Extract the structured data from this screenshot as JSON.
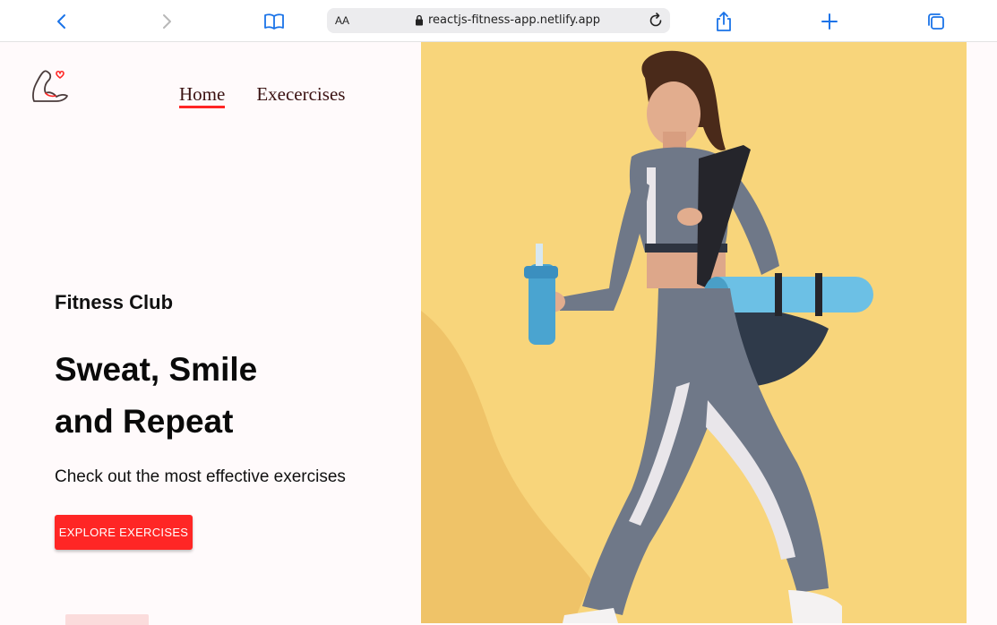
{
  "browser": {
    "aa_label": "AA",
    "url": "reactjs-fitness-app.netlify.app"
  },
  "nav": {
    "items": [
      {
        "label": "Home",
        "active": true
      },
      {
        "label": "Execercises",
        "active": false
      }
    ]
  },
  "hero": {
    "subtitle": "Fitness Club",
    "title_line1": "Sweat, Smile",
    "title_line2": "and Repeat",
    "description": "Check out the most effective exercises",
    "cta_label": "EXPLORE EXERCISES"
  },
  "colors": {
    "accent": "#ff2625",
    "page_bg": "#fffafb",
    "hero_bg": "#f8d57b",
    "nav_text": "#3a1212"
  },
  "icons": [
    "back-icon",
    "forward-icon",
    "bookmarks-icon",
    "lock-icon",
    "reload-icon",
    "share-icon",
    "new-tab-icon",
    "tabs-icon",
    "logo-icon"
  ]
}
